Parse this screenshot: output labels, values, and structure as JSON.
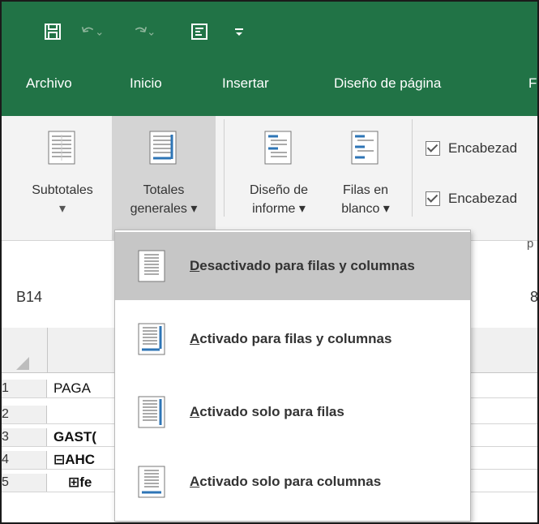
{
  "qat": {
    "icons": [
      "save-icon",
      "undo-icon",
      "redo-icon",
      "form-icon",
      "customize-icon"
    ]
  },
  "menu": {
    "tabs": [
      "Archivo",
      "Inicio",
      "Insertar",
      "Diseño de página",
      "F"
    ]
  },
  "ribbon": {
    "subtotales": {
      "line1": "Subtotales",
      "line2": "▾"
    },
    "totales": {
      "line1": "Totales",
      "line2": "generales ▾"
    },
    "diseno_informe": {
      "line1": "Diseño de",
      "line2": "informe ▾"
    },
    "filas_blanco": {
      "line1": "Filas en",
      "line2": "blanco ▾"
    },
    "checkboxes": [
      "Encabezad",
      "Encabezad"
    ],
    "group_label_fragment": "p"
  },
  "namebox": {
    "value": "B14"
  },
  "formula_fragment": "8",
  "rows": [
    {
      "num": "1",
      "text": "PAGA"
    },
    {
      "num": "2",
      "text": ""
    },
    {
      "num": "3",
      "text": "GAST("
    },
    {
      "num": "4",
      "text": "⊟AHC"
    },
    {
      "num": "5",
      "text": "⊞fe"
    }
  ],
  "dropdown": {
    "items": [
      {
        "accel": "D",
        "rest": "esactivado para filas y columnas",
        "highlight": true
      },
      {
        "accel": "A",
        "rest": "ctivado para filas y columnas",
        "highlight": false
      },
      {
        "accel": "A",
        "rest": "ctivado solo para filas",
        "highlight": false
      },
      {
        "accel": "A",
        "rest": "ctivado solo para columnas",
        "highlight": false
      }
    ]
  },
  "colors": {
    "ribbon_green": "#217346",
    "highlight": "#c6c6c6",
    "icon_blue": "#2e75b6"
  }
}
